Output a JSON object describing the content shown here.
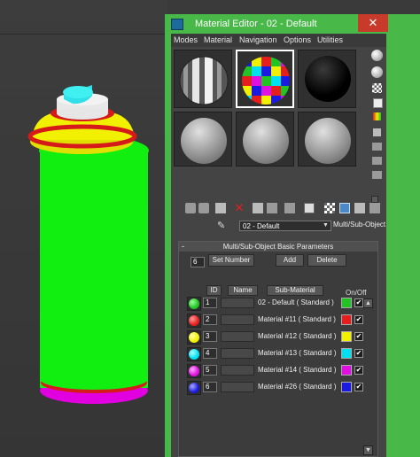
{
  "window": {
    "title": "Material Editor - 02 - Default",
    "close_glyph": "✕"
  },
  "menu": [
    "Modes",
    "Material",
    "Navigation",
    "Options",
    "Utilities"
  ],
  "sample_slots": [
    "slot-1-striped",
    "slot-2-checker",
    "slot-3-black",
    "slot-4-gray",
    "slot-5-gray",
    "slot-6-gray"
  ],
  "material": {
    "name": "02 - Default",
    "type": "Multi/Sub-Object"
  },
  "rollout": {
    "title": "Multi/Sub-Object Basic Parameters",
    "collapse_glyph": "-",
    "num_value": "6",
    "set_number": "Set Number",
    "add": "Add",
    "delete": "Delete",
    "headers": {
      "id": "ID",
      "name": "Name",
      "submaterial": "Sub-Material",
      "onoff": "On/Off"
    }
  },
  "rows": [
    {
      "id": "1",
      "submaterial": "02 - Default  ( Standard )",
      "color": "#22c322",
      "checked": "✔"
    },
    {
      "id": "2",
      "submaterial": "Material #11  ( Standard )",
      "color": "#e61e1e",
      "checked": "✔"
    },
    {
      "id": "3",
      "submaterial": "Material #12  ( Standard )",
      "color": "#f0f000",
      "checked": "✔"
    },
    {
      "id": "4",
      "submaterial": "Material #13  ( Standard )",
      "color": "#00e0f0",
      "checked": "✔"
    },
    {
      "id": "5",
      "submaterial": "Material #14  ( Standard )",
      "color": "#e010e0",
      "checked": "✔"
    },
    {
      "id": "6",
      "submaterial": "Material #26  ( Standard )",
      "color": "#1a1ae0",
      "checked": "✔"
    }
  ],
  "scroll": {
    "up": "▲",
    "down": "▼"
  },
  "icons": [
    "sphere-icon",
    "backlight-icon",
    "background-checker-icon",
    "sample-uv-icon",
    "video-check-icon",
    "options-icon",
    "select-by-material-icon",
    "get-material-icon",
    "put-to-scene-icon",
    "assign-icon",
    "reset-icon",
    "copy-icon",
    "unique-icon",
    "put-to-library-icon",
    "material-id-icon",
    "show-shaded-icon",
    "show-end-result-icon",
    "go-parent-icon",
    "eyedropper-icon"
  ]
}
